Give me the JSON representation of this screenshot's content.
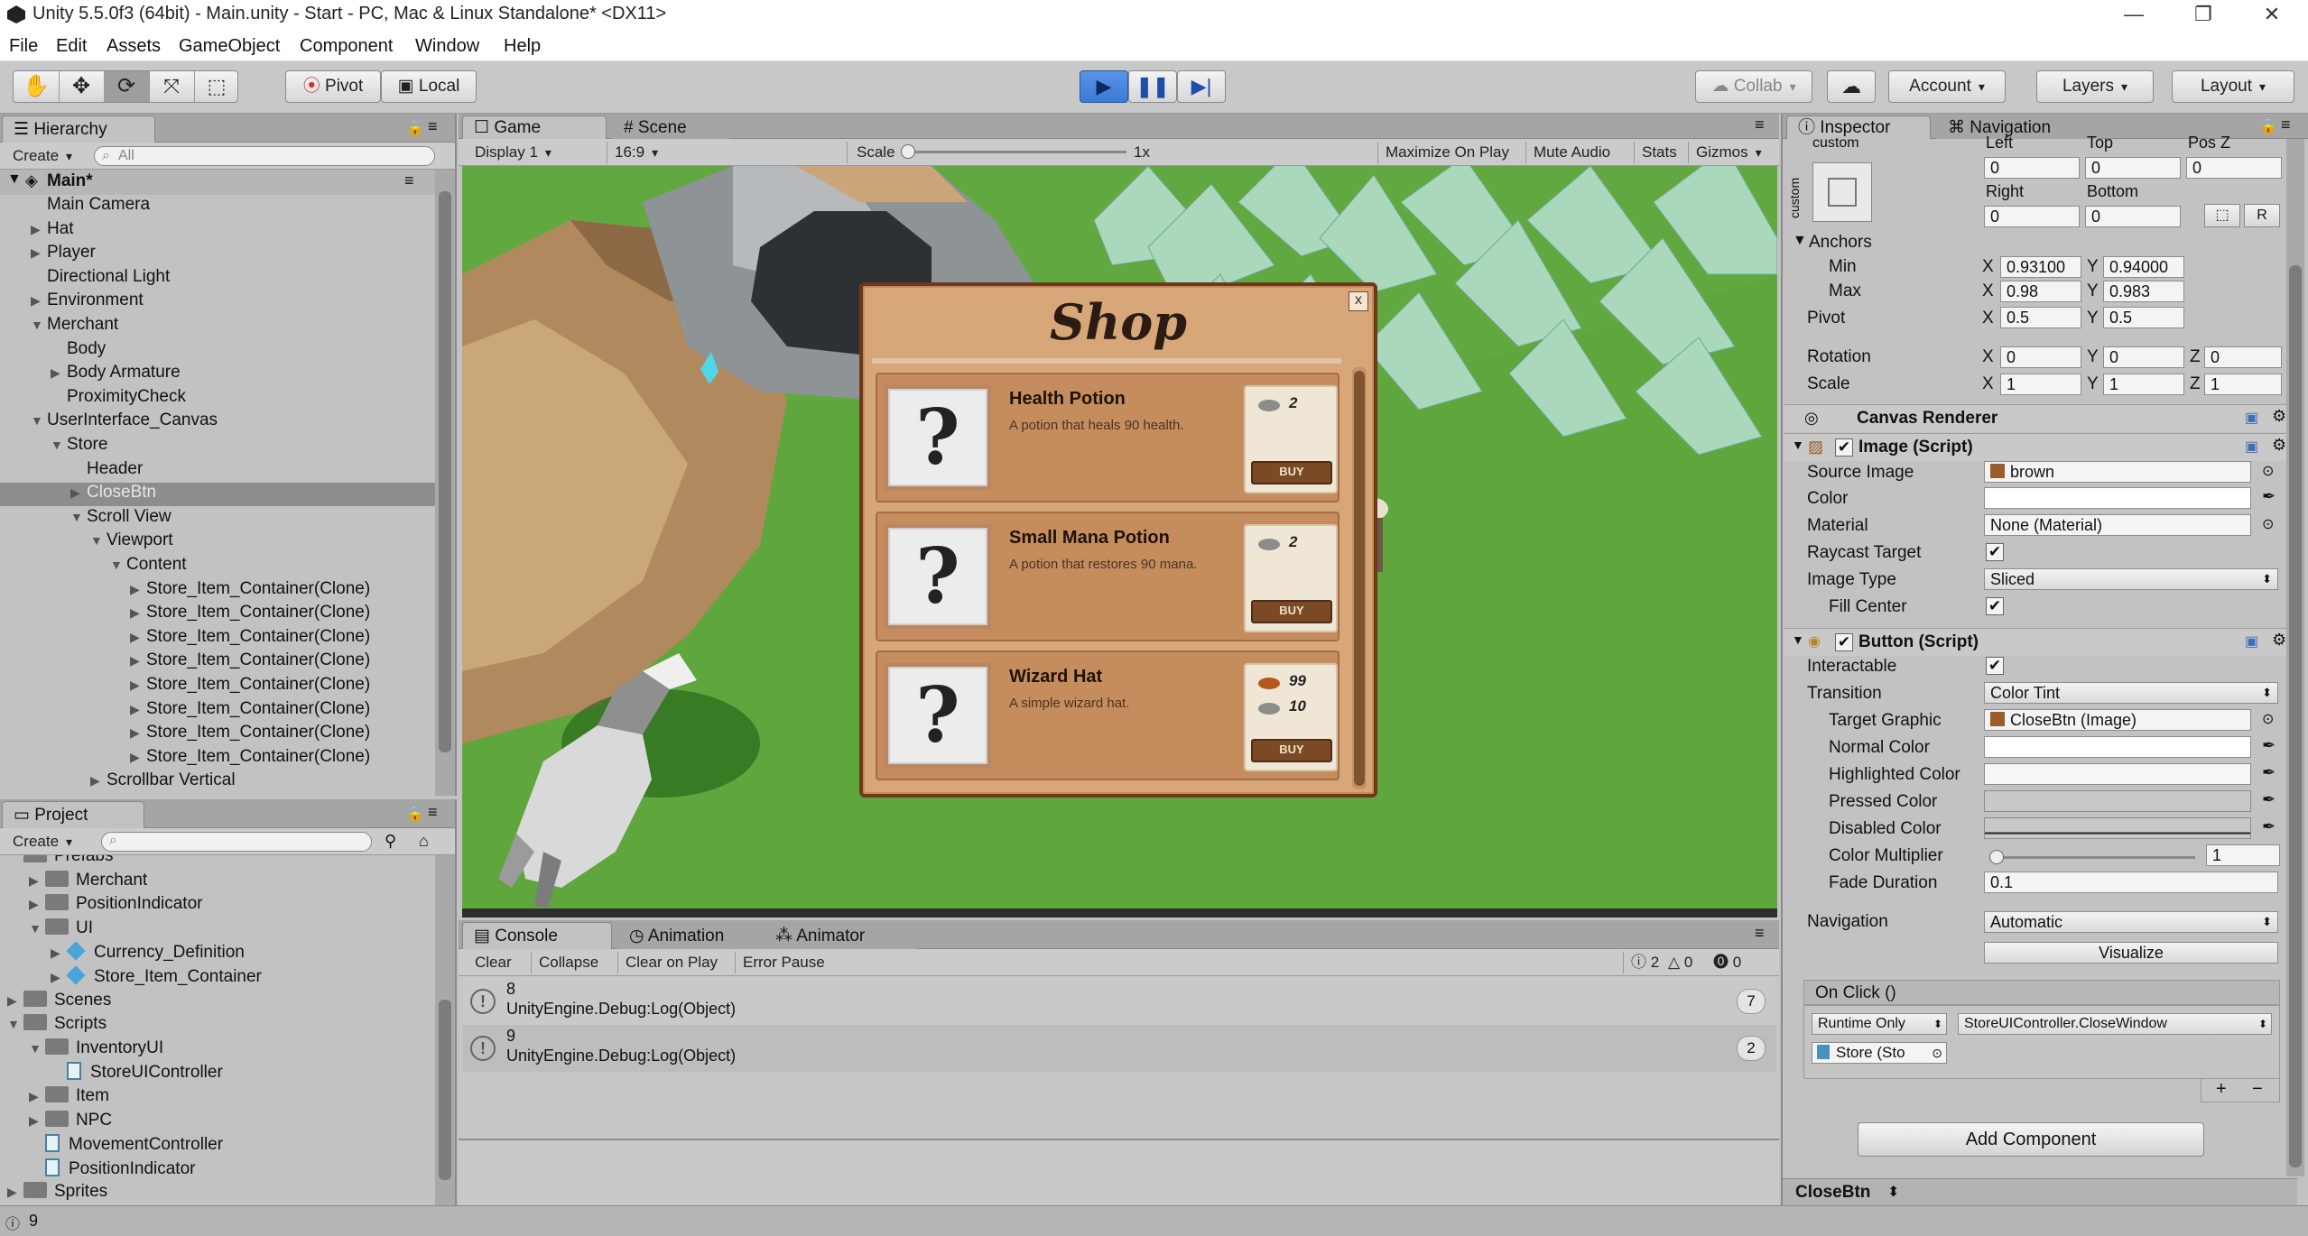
{
  "titlebar": {
    "title": "Unity 5.5.0f3 (64bit) - Main.unity - Start - PC, Mac & Linux Standalone* <DX11>",
    "minimize": "—",
    "restore": "❐",
    "close": "✕"
  },
  "menu": [
    "File",
    "Edit",
    "Assets",
    "GameObject",
    "Component",
    "Window",
    "Help"
  ],
  "toolbar": {
    "pivot": "Pivot",
    "local": "Local",
    "collab": "Collab",
    "account": "Account",
    "layers": "Layers",
    "layout": "Layout",
    "tools": [
      "hand-tool-icon",
      "move-tool-icon",
      "rotate-tool-icon",
      "scale-tool-icon",
      "rect-tool-icon"
    ]
  },
  "hierarchy": {
    "tab": "Hierarchy",
    "create": "Create",
    "search_placeholder": "All",
    "scene": "Main*",
    "items": [
      {
        "label": "Main Camera",
        "depth": 1,
        "arrow": ""
      },
      {
        "label": "Hat",
        "depth": 1,
        "arrow": "▶"
      },
      {
        "label": "Player",
        "depth": 1,
        "arrow": "▶"
      },
      {
        "label": "Directional Light",
        "depth": 1,
        "arrow": ""
      },
      {
        "label": "Environment",
        "depth": 1,
        "arrow": "▶"
      },
      {
        "label": "Merchant",
        "depth": 1,
        "arrow": "▼"
      },
      {
        "label": "Body",
        "depth": 2,
        "arrow": ""
      },
      {
        "label": "Body Armature",
        "depth": 2,
        "arrow": "▶"
      },
      {
        "label": "ProximityCheck",
        "depth": 2,
        "arrow": ""
      },
      {
        "label": "UserInterface_Canvas",
        "depth": 1,
        "arrow": "▼"
      },
      {
        "label": "Store",
        "depth": 2,
        "arrow": "▼"
      },
      {
        "label": "Header",
        "depth": 3,
        "arrow": ""
      },
      {
        "label": "CloseBtn",
        "depth": 3,
        "arrow": "▶",
        "selected": true
      },
      {
        "label": "Scroll View",
        "depth": 3,
        "arrow": "▼"
      },
      {
        "label": "Viewport",
        "depth": 4,
        "arrow": "▼"
      },
      {
        "label": "Content",
        "depth": 5,
        "arrow": "▼"
      },
      {
        "label": "Store_Item_Container(Clone)",
        "depth": 6,
        "arrow": "▶"
      },
      {
        "label": "Store_Item_Container(Clone)",
        "depth": 6,
        "arrow": "▶"
      },
      {
        "label": "Store_Item_Container(Clone)",
        "depth": 6,
        "arrow": "▶"
      },
      {
        "label": "Store_Item_Container(Clone)",
        "depth": 6,
        "arrow": "▶"
      },
      {
        "label": "Store_Item_Container(Clone)",
        "depth": 6,
        "arrow": "▶"
      },
      {
        "label": "Store_Item_Container(Clone)",
        "depth": 6,
        "arrow": "▶"
      },
      {
        "label": "Store_Item_Container(Clone)",
        "depth": 6,
        "arrow": "▶"
      },
      {
        "label": "Store_Item_Container(Clone)",
        "depth": 6,
        "arrow": "▶"
      },
      {
        "label": "Scrollbar Vertical",
        "depth": 4,
        "arrow": "▶"
      }
    ]
  },
  "project": {
    "tab": "Project",
    "create": "Create",
    "items": [
      {
        "label": "Prefabs",
        "depth": 1,
        "arrow": "",
        "kind": "folder"
      },
      {
        "label": "Merchant",
        "depth": 2,
        "arrow": "▶",
        "kind": "folder"
      },
      {
        "label": "PositionIndicator",
        "depth": 2,
        "arrow": "▶",
        "kind": "folder"
      },
      {
        "label": "UI",
        "depth": 2,
        "arrow": "▼",
        "kind": "folder"
      },
      {
        "label": "Currency_Definition",
        "depth": 3,
        "arrow": "▶",
        "kind": "prefab"
      },
      {
        "label": "Store_Item_Container",
        "depth": 3,
        "arrow": "▶",
        "kind": "prefab"
      },
      {
        "label": "Scenes",
        "depth": 1,
        "arrow": "▶",
        "kind": "folder"
      },
      {
        "label": "Scripts",
        "depth": 1,
        "arrow": "▼",
        "kind": "folder"
      },
      {
        "label": "InventoryUI",
        "depth": 2,
        "arrow": "▼",
        "kind": "folder"
      },
      {
        "label": "StoreUIController",
        "depth": 3,
        "arrow": "",
        "kind": "script"
      },
      {
        "label": "Item",
        "depth": 2,
        "arrow": "▶",
        "kind": "folder"
      },
      {
        "label": "NPC",
        "depth": 2,
        "arrow": "▶",
        "kind": "folder"
      },
      {
        "label": "MovementController",
        "depth": 2,
        "arrow": "",
        "kind": "script"
      },
      {
        "label": "PositionIndicator",
        "depth": 2,
        "arrow": "",
        "kind": "script"
      },
      {
        "label": "Sprites",
        "depth": 1,
        "arrow": "▶",
        "kind": "folder"
      }
    ]
  },
  "game": {
    "tab_game": "Game",
    "tab_scene": "Scene",
    "display": "Display 1",
    "aspect": "16:9",
    "scale_label": "Scale",
    "scale_value": "1x",
    "maximize": "Maximize On Play",
    "mute": "Mute Audio",
    "stats": "Stats",
    "gizmos": "Gizmos",
    "shop": {
      "title": "Shop",
      "close": "x",
      "items": [
        {
          "name": "Health Potion",
          "desc": "A potion that heals 90 health.",
          "prices": [
            {
              "coin": "silver",
              "amount": "2"
            }
          ],
          "buy": "BUY"
        },
        {
          "name": "Small Mana Potion",
          "desc": "A potion that restores 90 mana.",
          "prices": [
            {
              "coin": "silver",
              "amount": "2"
            }
          ],
          "buy": "BUY"
        },
        {
          "name": "Wizard Hat",
          "desc": "A simple wizard hat.",
          "prices": [
            {
              "coin": "copper",
              "amount": "99"
            },
            {
              "coin": "silver",
              "amount": "10"
            }
          ],
          "buy": "BUY"
        }
      ]
    }
  },
  "console": {
    "tab": "Console",
    "tab_animation": "Animation",
    "tab_animator": "Animator",
    "buttons": [
      "Clear",
      "Collapse",
      "Clear on Play",
      "Error Pause"
    ],
    "counts": {
      "log": "2",
      "warn": "0",
      "error": "0"
    },
    "entries": [
      {
        "line1": "8",
        "line2": "UnityEngine.Debug:Log(Object)",
        "count": "7"
      },
      {
        "line1": "9",
        "line2": "UnityEngine.Debug:Log(Object)",
        "count": "2"
      }
    ]
  },
  "inspector": {
    "tab": "Inspector",
    "tab_nav": "Navigation",
    "custom": "custom",
    "left_label": "Left",
    "top_label": "Top",
    "posz_label": "Pos Z",
    "right_label": "Right",
    "bottom_label": "Bottom",
    "left": "0",
    "top": "0",
    "posz": "0",
    "right": "0",
    "bottom": "0",
    "r_btn": "R",
    "anchors": "Anchors",
    "min": "Min",
    "max": "Max",
    "pivot": "Pivot",
    "rotation": "Rotation",
    "scale": "Scale",
    "min_x": "0.93100",
    "min_y": "0.94000",
    "max_x": "0.98",
    "max_y": "0.983",
    "pivot_x": "0.5",
    "pivot_y": "0.5",
    "rot_x": "0",
    "rot_y": "0",
    "rot_z": "0",
    "scale_x": "1",
    "scale_y": "1",
    "scale_z": "1",
    "canvas_renderer": "Canvas Renderer",
    "image_script": "Image (Script)",
    "source_image_label": "Source Image",
    "source_image": "brown",
    "color_label": "Color",
    "material_label": "Material",
    "material": "None (Material)",
    "raycast_label": "Raycast Target",
    "image_type_label": "Image Type",
    "image_type": "Sliced",
    "fill_center_label": "Fill Center",
    "button_script": "Button (Script)",
    "interactable_label": "Interactable",
    "transition_label": "Transition",
    "transition": "Color Tint",
    "target_graphic_label": "Target Graphic",
    "target_graphic": "CloseBtn (Image)",
    "normal_color_label": "Normal Color",
    "highlighted_color_label": "Highlighted Color",
    "pressed_color_label": "Pressed Color",
    "disabled_color_label": "Disabled Color",
    "color_multiplier_label": "Color Multiplier",
    "color_multiplier": "1",
    "fade_duration_label": "Fade Duration",
    "fade_duration": "0.1",
    "navigation_label": "Navigation",
    "navigation": "Automatic",
    "visualize": "Visualize",
    "onclick": "On Click ()",
    "runtime": "Runtime Only",
    "method": "StoreUIController.CloseWindow",
    "target": "Store (Sto",
    "add_component": "Add Component",
    "footer": "CloseBtn"
  },
  "status": {
    "text": "9"
  },
  "colors": {
    "play_active": "#3a7bd5",
    "selection": "#8d8d8d",
    "grass": "#5ea43c",
    "shop_bg": "#d7a77a"
  }
}
